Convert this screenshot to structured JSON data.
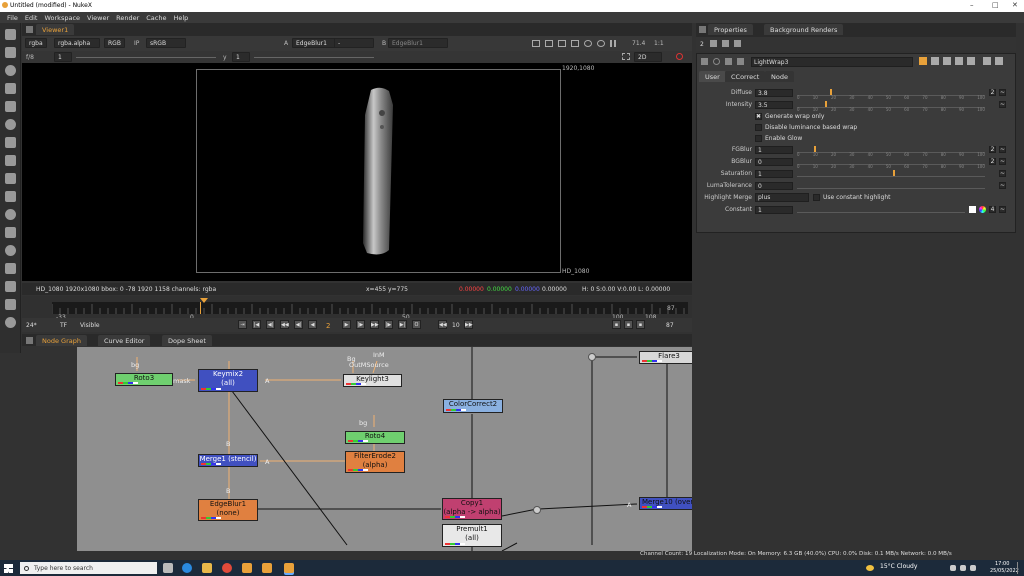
{
  "window": {
    "title": "Untitled (modified) - NukeX",
    "controls": [
      "–",
      "□",
      "✕"
    ]
  },
  "menu": [
    "File",
    "Edit",
    "Workspace",
    "Viewer",
    "Render",
    "Cache",
    "Help"
  ],
  "viewer": {
    "tab": "Viewer1",
    "channels": "rgba",
    "channel_alpha": "rgba.alpha",
    "color": "RGB",
    "ip": "IP",
    "lut": "sRGB",
    "a_input": "EdgeBlur1",
    "a_label": "A",
    "a_dash": "-",
    "b_label": "B",
    "b_input": "EdgeBlur1",
    "zoom": "71.4",
    "ratio": "1:1",
    "fstop": "f/8",
    "frame_field": "1",
    "y_label": "y",
    "y_value": "1",
    "view_mode": "2D",
    "corner_label": "1920,1080",
    "format_label": "HD_1080",
    "status_left": "HD_1080 1920x1080  bbox: 0 -78 1920 1158 channels: rgba",
    "status_xy": "x=455 y=775",
    "status_r": "0.00000",
    "status_g": "0.00000",
    "status_b": "0.00000",
    "status_a": "0.00000",
    "status_hsv": "H:  0 S:0.00 V:0.00  L: 0.00000"
  },
  "timeline": {
    "ticks": [
      "-33",
      "0",
      "50",
      "100",
      "108"
    ],
    "end": "87",
    "fps": "24*",
    "tf": "TF",
    "visible": "Visible",
    "current_frame": "2",
    "step": "10",
    "end_frame": "87"
  },
  "node_graph": {
    "tabs": [
      "Node Graph",
      "Curve Editor",
      "Dope Sheet"
    ],
    "nodes": [
      {
        "id": "roto3",
        "label": "Roto3",
        "sub": ""
      },
      {
        "id": "keymix2",
        "label": "Keymix2",
        "sub": "(all)"
      },
      {
        "id": "keylight3",
        "label": "Keylight3",
        "sub": ""
      },
      {
        "id": "colorcorrect2",
        "label": "ColorCorrect2",
        "sub": ""
      },
      {
        "id": "flare3",
        "label": "Flare3",
        "sub": ""
      },
      {
        "id": "roto4",
        "label": "Roto4",
        "sub": ""
      },
      {
        "id": "filtererode2",
        "label": "FilterErode2",
        "sub": "(alpha)"
      },
      {
        "id": "merge1",
        "label": "Merge1 (stencil)",
        "sub": ""
      },
      {
        "id": "edgeblur1",
        "label": "EdgeBlur1",
        "sub": "(none)"
      },
      {
        "id": "copy1",
        "label": "Copy1",
        "sub": "(alpha -> alpha)"
      },
      {
        "id": "premult1",
        "label": "Premult1",
        "sub": "(all)"
      },
      {
        "id": "merge10",
        "label": "Merge10 (over)",
        "sub": ""
      }
    ],
    "edge_labels": [
      "bg",
      "mask",
      "A",
      "B",
      "Bg",
      "InM",
      "OutMSource",
      "bg",
      "A",
      "B",
      "A"
    ]
  },
  "properties": {
    "tabs": [
      "Properties",
      "Background Renders"
    ],
    "count": "2",
    "node_name": "LightWrap3",
    "subtabs": [
      "User",
      "CCorrect",
      "Node"
    ],
    "params": [
      {
        "label": "Diffuse",
        "value": "3.8"
      },
      {
        "label": "Intensity",
        "value": "3.5"
      }
    ],
    "checks": [
      {
        "label": "Generate wrap only",
        "checked": "✖"
      },
      {
        "label": "Disable luminance based wrap",
        "checked": ""
      },
      {
        "label": "Enable Glow",
        "checked": ""
      }
    ],
    "params2": [
      {
        "label": "FGBlur",
        "value": "1"
      },
      {
        "label": "BGBlur",
        "value": "0"
      },
      {
        "label": "Saturation",
        "value": "1"
      },
      {
        "label": "LumaTolerance",
        "value": "0"
      }
    ],
    "highlight_merge_label": "Highlight Merge",
    "highlight_merge_value": "plus",
    "use_constant": "Use constant highlight",
    "constant_label": "Constant",
    "constant_value": "1",
    "constant_count": "4",
    "ticks": [
      "0",
      "10",
      "20",
      "30",
      "40",
      "50",
      "60",
      "70",
      "80",
      "90",
      "100"
    ]
  },
  "status_bar": "Channel Count: 19  Localization Mode: On  Memory: 6.3 GB (40.0%)  CPU: 0.0%  Disk: 0.1 MB/s  Network: 0.0 MB/s",
  "taskbar": {
    "search_placeholder": "Type here to search",
    "weather": "15°C  Cloudy",
    "time": "17:00",
    "date": "25/05/2022"
  },
  "colors": {
    "accent": "#e8a13a",
    "viewer_bg": "#000000",
    "graph_bg": "#8f8f8f"
  }
}
